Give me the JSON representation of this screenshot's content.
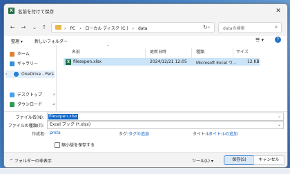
{
  "window": {
    "title": "名前を付けて保存",
    "app_icon": "X",
    "close": "✕"
  },
  "nav": {
    "back": "←",
    "forward": "→",
    "dropdown": "⌄",
    "up": "↑",
    "breadcrumbs": [
      "›",
      "PC",
      "›",
      "ローカル ディスク (C:)",
      "›",
      "data"
    ],
    "address_dropdown": "⌄",
    "refresh": "↻",
    "search_placeholder": "dataの検索",
    "search_icon": "⌕"
  },
  "cmdbar": {
    "organize": "整理 ▾",
    "new_folder": "新しいフォルダー",
    "view_icon": "☰ ▾",
    "help": "?"
  },
  "sidebar": {
    "items": [
      {
        "label": "ホーム",
        "icon": "home-icon",
        "color": "#e0833a"
      },
      {
        "label": "ギャラリー",
        "icon": "gallery-icon",
        "color": "#3a8fd9"
      },
      {
        "label": "OneDrive - Pers",
        "icon": "cloud-icon",
        "color": "#2a7fd4",
        "expander": "›"
      },
      {
        "label": "デスクトップ",
        "icon": "desktop-icon",
        "color": "#4aa0e6",
        "pin": "📌"
      },
      {
        "label": "ダウンロード",
        "icon": "download-icon",
        "color": "#2f9a55",
        "pin": "📌"
      }
    ]
  },
  "columns": [
    "名前",
    "更新日時",
    "種類",
    "サイズ"
  ],
  "sort_indicator": "^",
  "files": [
    {
      "name": "filesopen.xlsx",
      "modified": "2024/12/21 12:05",
      "type": "Microsoft Excel ワ...",
      "size": "12 KB"
    }
  ],
  "form": {
    "filename_label": "ファイル名(N):",
    "filename_value": "filesopen.xlsx",
    "filetype_label": "ファイルの種類(T):",
    "filetype_value": "Excel ブック (*.xlsx)",
    "author_label": "作成者:",
    "author_value": "pmta",
    "tags_label": "タグ:",
    "tags_value": "タグの追加",
    "title_label": "タイトル:",
    "title_value": "タイトルの追加",
    "thumbnail_label": "縮小版を保存する",
    "chevron": "⌄"
  },
  "footer": {
    "hide_folders": "^  フォルダーの非表示",
    "tools": "ツール(L)  ▾",
    "save": "保存(S)",
    "cancel": "キャンセル"
  }
}
